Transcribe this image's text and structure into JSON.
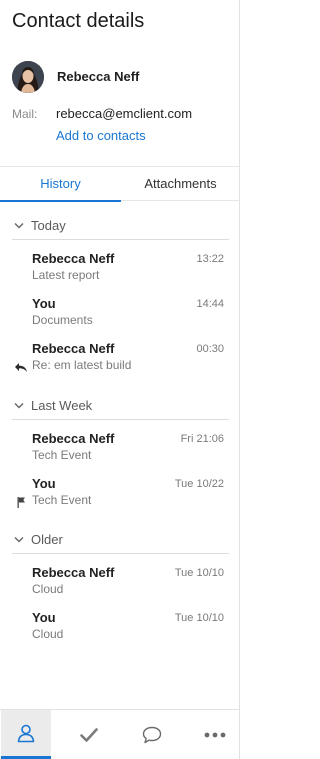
{
  "header": {
    "title": "Contact details"
  },
  "contact": {
    "name": "Rebecca Neff",
    "mail_label": "Mail:",
    "email": "rebecca@emclient.com",
    "add_link": "Add to contacts"
  },
  "tabs": [
    {
      "label": "History",
      "active": true
    },
    {
      "label": "Attachments",
      "active": false
    }
  ],
  "groups": [
    {
      "label": "Today",
      "items": [
        {
          "sender": "Rebecca Neff",
          "subject": "Latest report",
          "time": "13:22",
          "icon": ""
        },
        {
          "sender": "You",
          "subject": "Documents",
          "time": "14:44",
          "icon": ""
        },
        {
          "sender": "Rebecca Neff",
          "subject": "Re: em latest build",
          "time": "00:30",
          "icon": "reply-icon"
        }
      ]
    },
    {
      "label": "Last Week",
      "items": [
        {
          "sender": "Rebecca Neff",
          "subject": "Tech Event",
          "time": "Fri 21:06",
          "icon": ""
        },
        {
          "sender": "You",
          "subject": "Tech Event",
          "time": "Tue 10/22",
          "icon": "flag-icon"
        }
      ]
    },
    {
      "label": "Older",
      "items": [
        {
          "sender": "Rebecca Neff",
          "subject": "Cloud",
          "time": "Tue 10/10",
          "icon": ""
        },
        {
          "sender": "You",
          "subject": "Cloud",
          "time": "Tue 10/10",
          "icon": ""
        }
      ]
    }
  ],
  "bottom_nav": [
    {
      "icon": "contact-person-icon",
      "active": true
    },
    {
      "icon": "checkmark-icon",
      "active": false
    },
    {
      "icon": "chat-bubble-icon",
      "active": false
    },
    {
      "icon": "more-dots-icon",
      "active": false
    }
  ],
  "colors": {
    "accent": "#1976d2",
    "muted_text": "#7a7a7a",
    "divider": "#dcdcdc"
  }
}
